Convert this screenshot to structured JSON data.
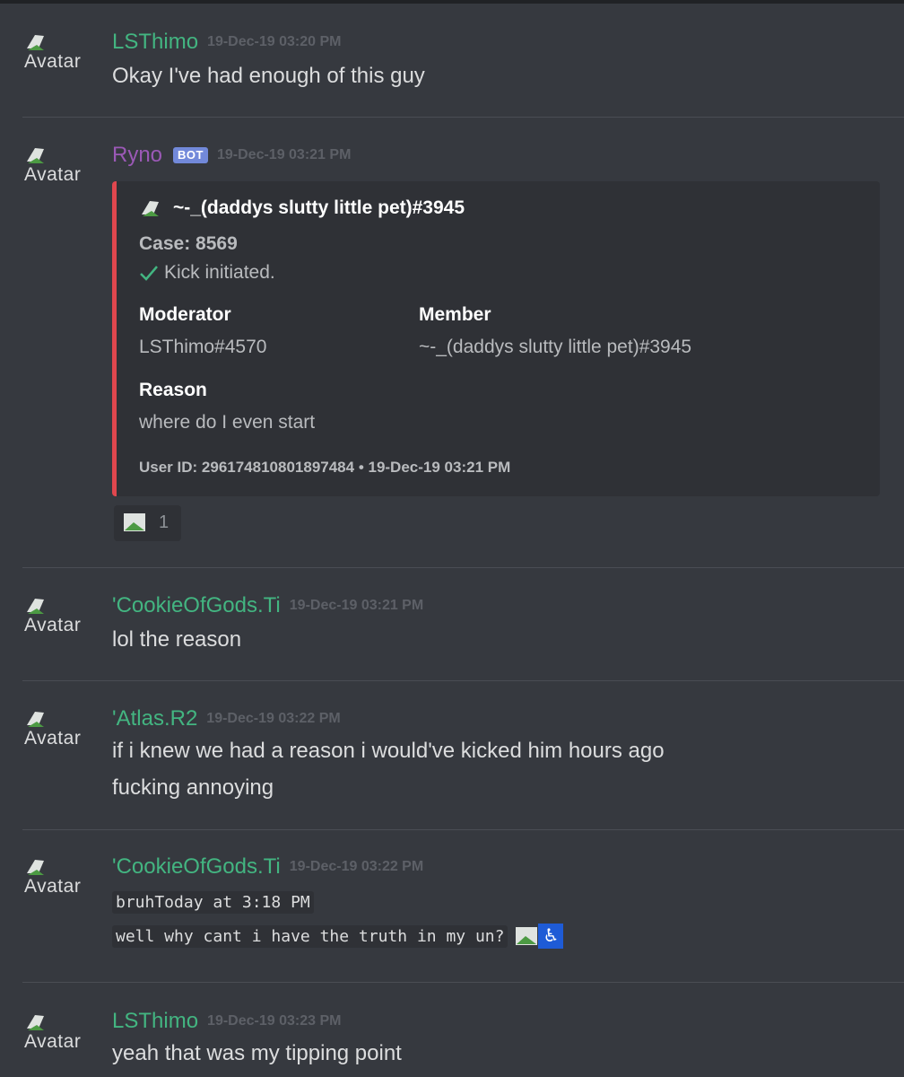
{
  "colors": {
    "background": "#36393f",
    "username_green": "#43b581",
    "username_purple": "#9b59b6",
    "bot_badge": "#7289da",
    "embed_border": "#e0474e"
  },
  "avatar_alt": "Avatar",
  "messages": [
    {
      "author": "LSThimo",
      "timestamp": "19-Dec-19 03:20 PM",
      "lines": [
        "Okay I've had enough of this guy"
      ]
    },
    {
      "author": "Ryno",
      "badge": "BOT",
      "timestamp": "19-Dec-19 03:21 PM",
      "embed": {
        "author": "~-_(daddys slutty little pet)#3945",
        "case": "Case: 8569",
        "status": "Kick initiated.",
        "fields": [
          {
            "name": "Moderator",
            "value": "LSThimo#4570"
          },
          {
            "name": "Member",
            "value": "~-_(daddys slutty little pet)#3945"
          },
          {
            "name": "Reason",
            "value": "where do I even start"
          }
        ],
        "footer": "User ID: 296174810801897484 • 19-Dec-19 03:21 PM"
      },
      "reaction": {
        "icon": "broken-image-icon",
        "count": "1"
      }
    },
    {
      "author": "'CookieOfGods.Ti",
      "timestamp": "19-Dec-19 03:21 PM",
      "lines": [
        "lol the reason"
      ]
    },
    {
      "author": "'Atlas.R2",
      "timestamp": "19-Dec-19 03:22 PM",
      "lines": [
        "if i knew we had a reason i would've kicked him hours ago",
        "fucking annoying"
      ]
    },
    {
      "author": "'CookieOfGods.Ti",
      "timestamp": "19-Dec-19 03:22 PM",
      "code_lines": [
        "bruhToday at 3:18 PM",
        "well why cant i have the truth in my un?"
      ],
      "emoji": [
        "broken-image-icon",
        "wheelchair-icon"
      ]
    },
    {
      "author": "LSThimo",
      "timestamp": "19-Dec-19 03:23 PM",
      "lines": [
        "yeah that was my tipping point"
      ]
    }
  ]
}
